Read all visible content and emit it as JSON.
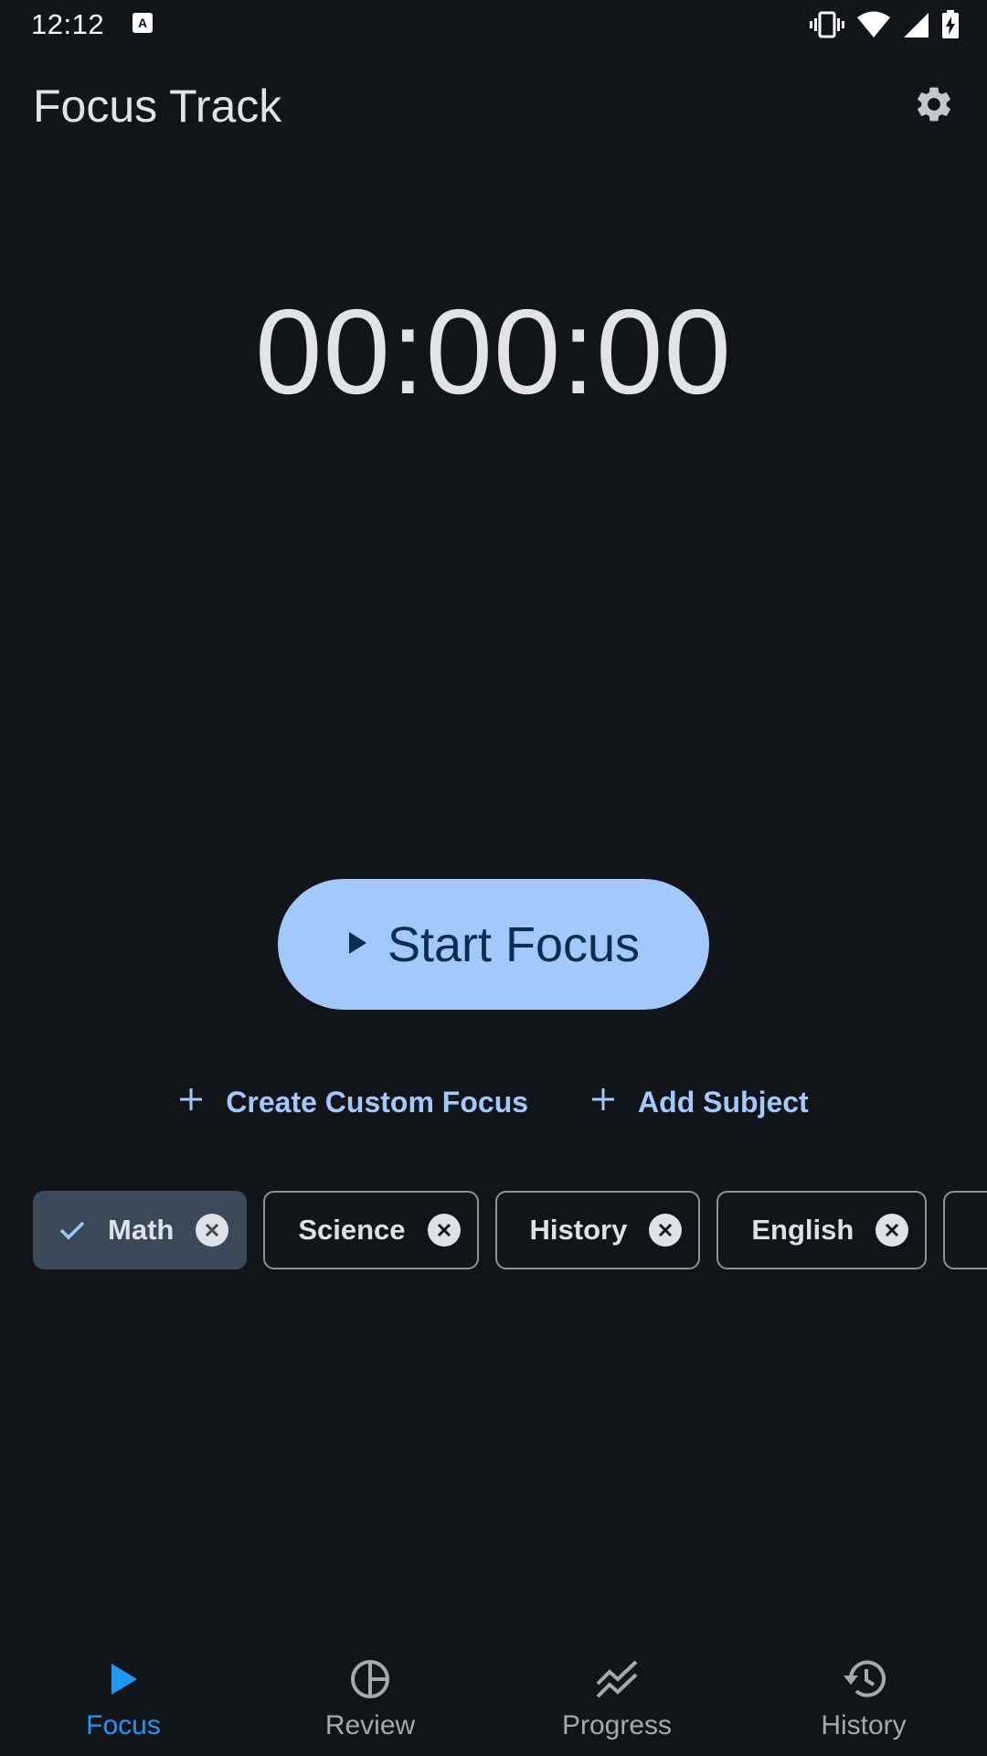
{
  "status_bar": {
    "time": "12:12"
  },
  "app_bar": {
    "title": "Focus Track",
    "settings_icon": "gear-icon"
  },
  "timer": {
    "display": "00:00:00"
  },
  "primary_action": {
    "label": "Start Focus",
    "icon": "play-icon"
  },
  "secondary_actions": [
    {
      "label": "Create Custom Focus",
      "icon": "plus-icon"
    },
    {
      "label": "Add Subject",
      "icon": "plus-icon"
    }
  ],
  "subjects": [
    {
      "label": "Math",
      "selected": true
    },
    {
      "label": "Science",
      "selected": false
    },
    {
      "label": "History",
      "selected": false
    },
    {
      "label": "English",
      "selected": false
    }
  ],
  "bottom_nav": [
    {
      "label": "Focus",
      "icon": "play-icon",
      "active": true
    },
    {
      "label": "Review",
      "icon": "pie-chart-icon",
      "active": false
    },
    {
      "label": "Progress",
      "icon": "trending-icon",
      "active": false
    },
    {
      "label": "History",
      "icon": "history-icon",
      "active": false
    }
  ],
  "colors": {
    "background": "#111418",
    "primary": "#a3c9fc",
    "active_nav": "#2196f3",
    "selected_chip": "#3b4858"
  }
}
